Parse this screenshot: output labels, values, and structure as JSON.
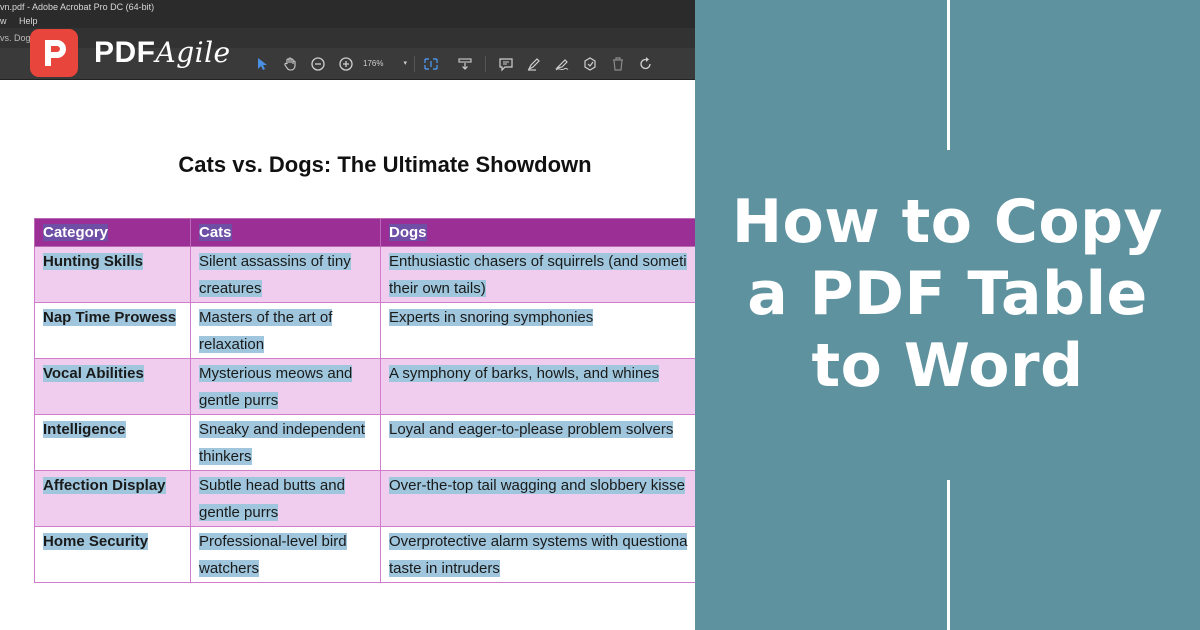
{
  "app": {
    "window_title": "vn.pdf - Adobe Acrobat Pro DC (64-bit)",
    "menu": [
      "w",
      "Help"
    ],
    "tab_label": "vs. Dogs",
    "zoom": "176%"
  },
  "logo": {
    "pdf": "PDF",
    "agile": "Agile",
    "badge_letter": "P"
  },
  "document": {
    "title": "Cats vs. Dogs: The Ultimate Showdown",
    "table": {
      "headers": [
        "Category",
        "Cats",
        "Dogs"
      ],
      "rows": [
        {
          "category": "Hunting Skills",
          "cats": "Silent assassins of tiny creatures",
          "dogs": "Enthusiastic chasers of squirrels (and someti their own tails)"
        },
        {
          "category": "Nap Time Prowess",
          "cats": "Masters of the art of relaxation",
          "dogs": "Experts in snoring symphonies"
        },
        {
          "category": "Vocal Abilities",
          "cats": "Mysterious meows and gentle purrs",
          "dogs": "A symphony of barks, howls, and whines"
        },
        {
          "category": "Intelligence",
          "cats": "Sneaky and independent thinkers",
          "dogs": "Loyal and eager-to-please problem solvers"
        },
        {
          "category": "Affection Display",
          "cats": "Subtle head butts and gentle purrs",
          "dogs": "Over-the-top tail wagging and slobbery kisse"
        },
        {
          "category": "Home Security",
          "cats": "Professional-level bird watchers",
          "dogs": "Overprotective alarm systems with questiona taste in intruders"
        }
      ]
    }
  },
  "headline": {
    "line1": "How to Copy",
    "line2": "a PDF Table",
    "line3": "to Word"
  },
  "colors": {
    "panel": "#5e929f",
    "header_row": "#9b2f96",
    "shaded_row": "#f0cdef",
    "selection": "#9fc6dd",
    "logo_red": "#e8453c"
  },
  "icons": [
    "pointer-icon",
    "hand-icon",
    "zoom-out-icon",
    "zoom-in-icon",
    "fit-page-icon",
    "scroll-mode-icon",
    "comment-icon",
    "highlight-icon",
    "sign-icon",
    "stamp-icon",
    "delete-icon",
    "rotate-icon"
  ]
}
